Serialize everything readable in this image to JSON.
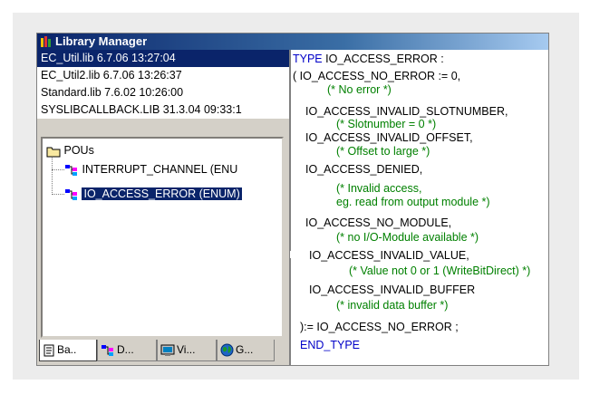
{
  "window": {
    "title": "Library Manager"
  },
  "libraries": [
    "EC_Util.lib 6.7.06 13:27:04",
    "EC_Util2.lib 6.7.06 13:26:37",
    "Standard.lib 7.6.02 10:26:00",
    "SYSLIBCALLBACK.LIB 31.3.04 09:33:1"
  ],
  "selected_library_index": 0,
  "tree": {
    "root": "POUs",
    "children": [
      "INTERRUPT_CHANNEL (ENU",
      "IO_ACCESS_ERROR (ENUM)"
    ],
    "selected_child_index": 1
  },
  "tabs": [
    {
      "label": "Ba..",
      "icon": "document-icon"
    },
    {
      "label": "D...",
      "icon": "datatype-icon"
    },
    {
      "label": "Vi...",
      "icon": "visualization-icon"
    },
    {
      "label": "G...",
      "icon": "globe-icon"
    }
  ],
  "code": {
    "type_kw": "TYPE",
    "type_name": " IO_ACCESS_ERROR :",
    "l1": "( IO_ACCESS_NO_ERROR := 0,",
    "c1": "(* No error *)",
    "l2": "IO_ACCESS_INVALID_SLOTNUMBER,",
    "c2": "(* Slotnumber = 0 *)",
    "l3": "IO_ACCESS_INVALID_OFFSET,",
    "c3": "(* Offset to large *)",
    "l4": "IO_ACCESS_DENIED,",
    "c4a": "(* Invalid access,",
    "c4b": "eg. read from output module *)",
    "l5": "IO_ACCESS_NO_MODULE,",
    "c5": "(* no I/O-Module available *)",
    "l6": "IO_ACCESS_INVALID_VALUE,",
    "c6": "(* Value not 0 or 1 (WriteBitDirect) *)",
    "l7": "IO_ACCESS_INVALID_BUFFER",
    "c7": "(* invalid data buffer *)",
    "l8": "):= IO_ACCESS_NO_ERROR ;",
    "end_kw": "END_TYPE"
  },
  "colors": {
    "keyword": "#0000c8",
    "comment": "#008000",
    "selection": "#0a246a"
  }
}
